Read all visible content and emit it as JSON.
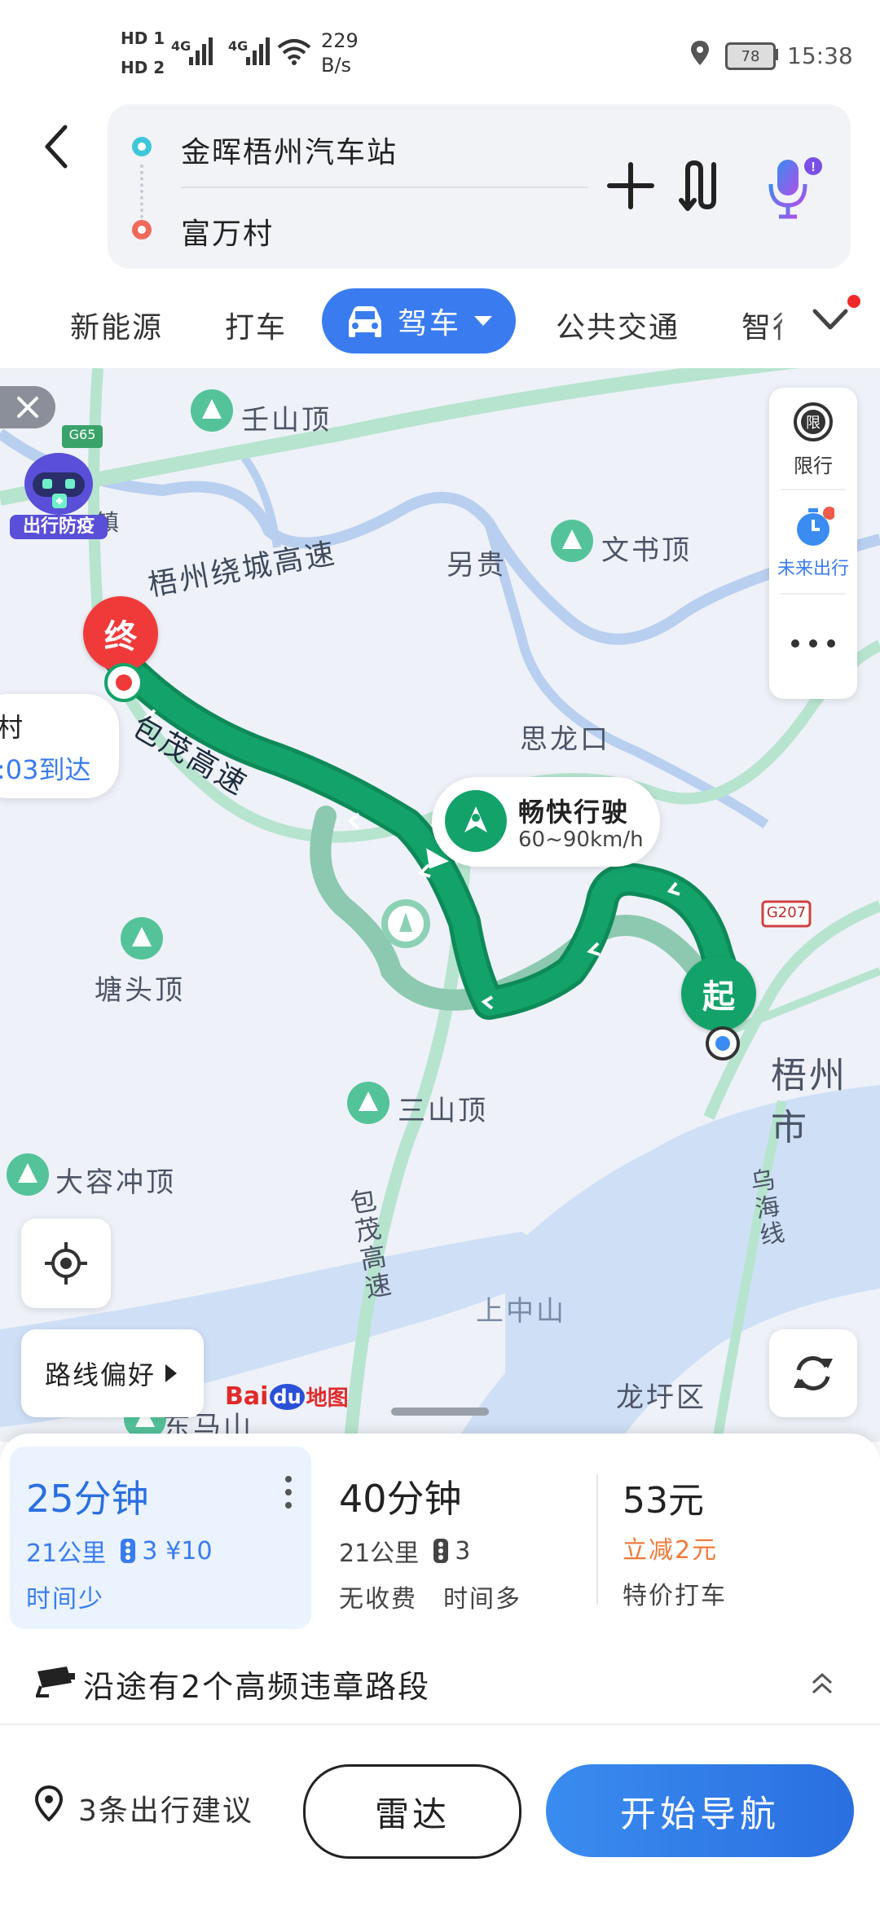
{
  "status_bar": {
    "hd1": "HD 1",
    "hd2": "HD 2",
    "net1": "4G",
    "net2": "4G",
    "speed_value": "229",
    "speed_unit": "B/s",
    "battery": "78",
    "time": "15:38"
  },
  "route": {
    "origin": "金晖梧州汽车站",
    "destination": "富万村"
  },
  "mode_tabs": {
    "new_energy": "新能源",
    "taxi": "打车",
    "drive": "驾车",
    "transit": "公共交通",
    "smart": "智行"
  },
  "map": {
    "side_panel": {
      "restrict": "限行",
      "future_trip": "未来出行"
    },
    "labels": {
      "renshanding": "壬山顶",
      "wenshuding": "文书顶",
      "linggui": "另贵",
      "silongkou": "思龙口",
      "tangtouding": "塘头顶",
      "sanshanding": "三山顶",
      "darongchongding": "大容冲顶",
      "shangzhongshan": "上中山",
      "longxuqu": "龙圩区",
      "wuzhoushi": "梧州市",
      "wuhaixian": "乌海线",
      "dongmashan": "东马山",
      "baomao_hwy": "包茂高速",
      "baomao_hwy2": "包茂高速",
      "ring_hwy": "梧州绕城高速",
      "zhen": "镇",
      "g65": "G65",
      "g207": "G207"
    },
    "badge": "出行防疫",
    "end_marker": "终",
    "start_marker": "起",
    "eta_card": {
      "line1": "村",
      "line2": ":03到达"
    },
    "traffic_bubble": {
      "title": "畅快行驶",
      "speed": "60~90km/h"
    },
    "route_pref": "路线偏好",
    "logo": {
      "bai": "Bai",
      "du": "du",
      "ditu": "地图"
    }
  },
  "routes": [
    {
      "time": "25分钟",
      "dist": "21公里",
      "lights": "3",
      "toll": "¥10",
      "tag": "时间少"
    },
    {
      "time": "40分钟",
      "dist": "21公里",
      "lights": "3",
      "tag1": "无收费",
      "tag2": "时间多"
    },
    {
      "price": "53元",
      "discount": "立减2元",
      "tag": "特价打车"
    }
  ],
  "violation_notice": "沿途有2个高频违章路段",
  "bottom": {
    "suggest": "3条出行建议",
    "radar": "雷达",
    "navigate": "开始导航"
  },
  "colors": {
    "accent": "#3a7cf0",
    "route_green": "#13a36a",
    "alt_route": "#8cc9b0",
    "end_red": "#f03a3a",
    "discount_orange": "#f07a3a"
  }
}
